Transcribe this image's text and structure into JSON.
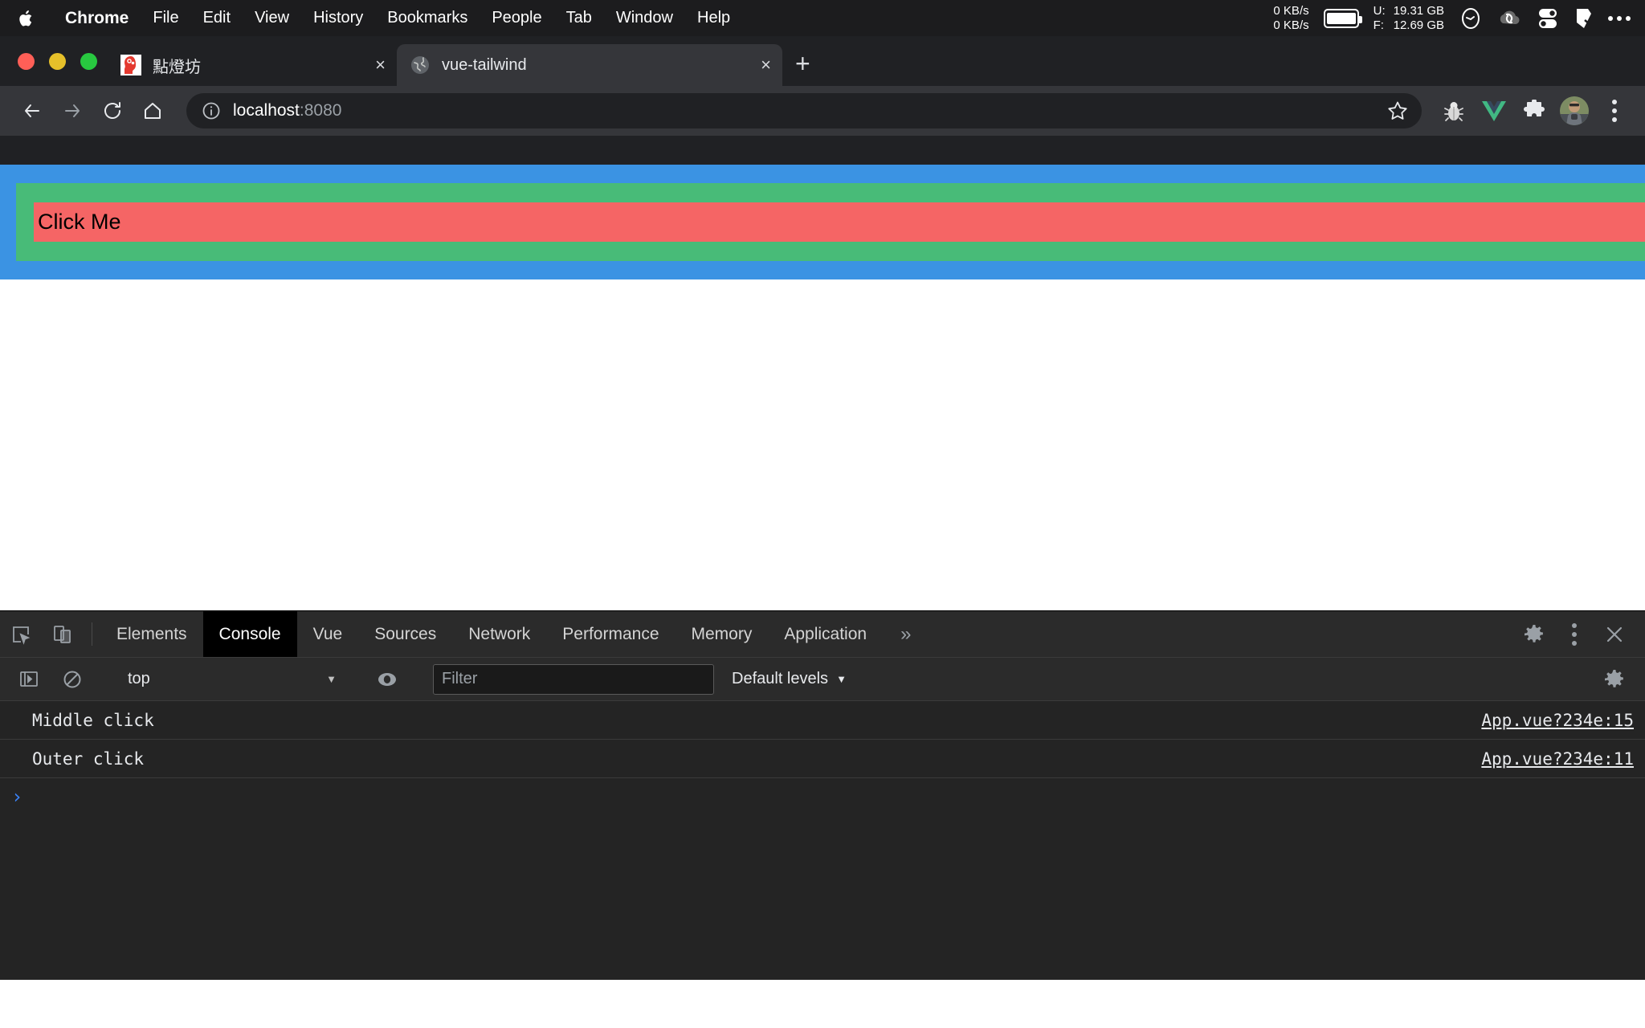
{
  "menubar": {
    "apple_icon": "apple-logo",
    "items": [
      {
        "label": "Chrome",
        "bold": true
      },
      {
        "label": "File",
        "bold": false
      },
      {
        "label": "Edit",
        "bold": false
      },
      {
        "label": "View",
        "bold": false
      },
      {
        "label": "History",
        "bold": false
      },
      {
        "label": "Bookmarks",
        "bold": false
      },
      {
        "label": "People",
        "bold": false
      },
      {
        "label": "Tab",
        "bold": false
      },
      {
        "label": "Window",
        "bold": false
      },
      {
        "label": "Help",
        "bold": false
      }
    ],
    "network": {
      "up": "0 KB/s",
      "down": "0 KB/s"
    },
    "disk": {
      "used_label": "U:",
      "used_value": "19.31 GB",
      "free_label": "F:",
      "free_value": "12.69 GB"
    },
    "status_icons": [
      "clock-icon",
      "cloud-sync-icon",
      "toggles-icon",
      "shield-icon",
      "ellipsis-icon"
    ]
  },
  "browser": {
    "traffic_lights": [
      {
        "name": "close-window-button",
        "color": "#ff5f57"
      },
      {
        "name": "minimize-window-button",
        "color": "#e6c02a"
      },
      {
        "name": "maximize-window-button",
        "color": "#28c840"
      }
    ],
    "tabs": [
      {
        "title": "點燈坊",
        "favicon": "head-lightbulb-favicon",
        "active": false,
        "close_label": "×"
      },
      {
        "title": "vue-tailwind",
        "favicon": "globe-favicon",
        "active": true,
        "close_label": "×"
      }
    ],
    "new_tab_label": "+",
    "nav": {
      "back_icon": "back-arrow-icon",
      "forward_icon": "forward-arrow-icon",
      "reload_icon": "reload-icon",
      "home_icon": "home-icon",
      "info_icon": "info-circle-icon",
      "url_host": "localhost",
      "url_port": ":8080",
      "url_full": "localhost:8080",
      "star_icon": "bookmark-star-icon"
    },
    "extensions": [
      {
        "name": "bug-extension-icon"
      },
      {
        "name": "vue-devtools-icon"
      },
      {
        "name": "puzzle-extensions-icon"
      }
    ],
    "profile_avatar": "profile-avatar",
    "menu_icon": "chrome-menu-icon"
  },
  "page": {
    "outer_box_color": "#3b93e3",
    "middle_box_color": "#48bb78",
    "inner_box_color": "#f56565",
    "button_label": "Click Me"
  },
  "devtools": {
    "inspect_icon": "inspect-element-icon",
    "device_icon": "device-toolbar-icon",
    "tabs": [
      {
        "label": "Elements",
        "active": false
      },
      {
        "label": "Console",
        "active": true
      },
      {
        "label": "Vue",
        "active": false
      },
      {
        "label": "Sources",
        "active": false
      },
      {
        "label": "Network",
        "active": false
      },
      {
        "label": "Performance",
        "active": false
      },
      {
        "label": "Memory",
        "active": false
      },
      {
        "label": "Application",
        "active": false
      }
    ],
    "more_tabs_label": "»",
    "settings_icon": "gear-icon",
    "dots_icon": "more-options-icon",
    "close_icon": "close-devtools-icon",
    "toolbar": {
      "sidebar_icon": "console-sidebar-icon",
      "clear_icon": "clear-console-icon",
      "context": "top",
      "context_caret": "▼",
      "eye_icon": "live-expression-icon",
      "filter_placeholder": "Filter",
      "filter_value": "",
      "levels_label": "Default levels",
      "levels_caret": "▼",
      "settings_icon": "console-settings-icon"
    },
    "console_messages": [
      {
        "text": "Middle click",
        "source": "App.vue?234e:15"
      },
      {
        "text": "Outer click",
        "source": "App.vue?234e:11"
      }
    ],
    "prompt_caret": "›"
  }
}
